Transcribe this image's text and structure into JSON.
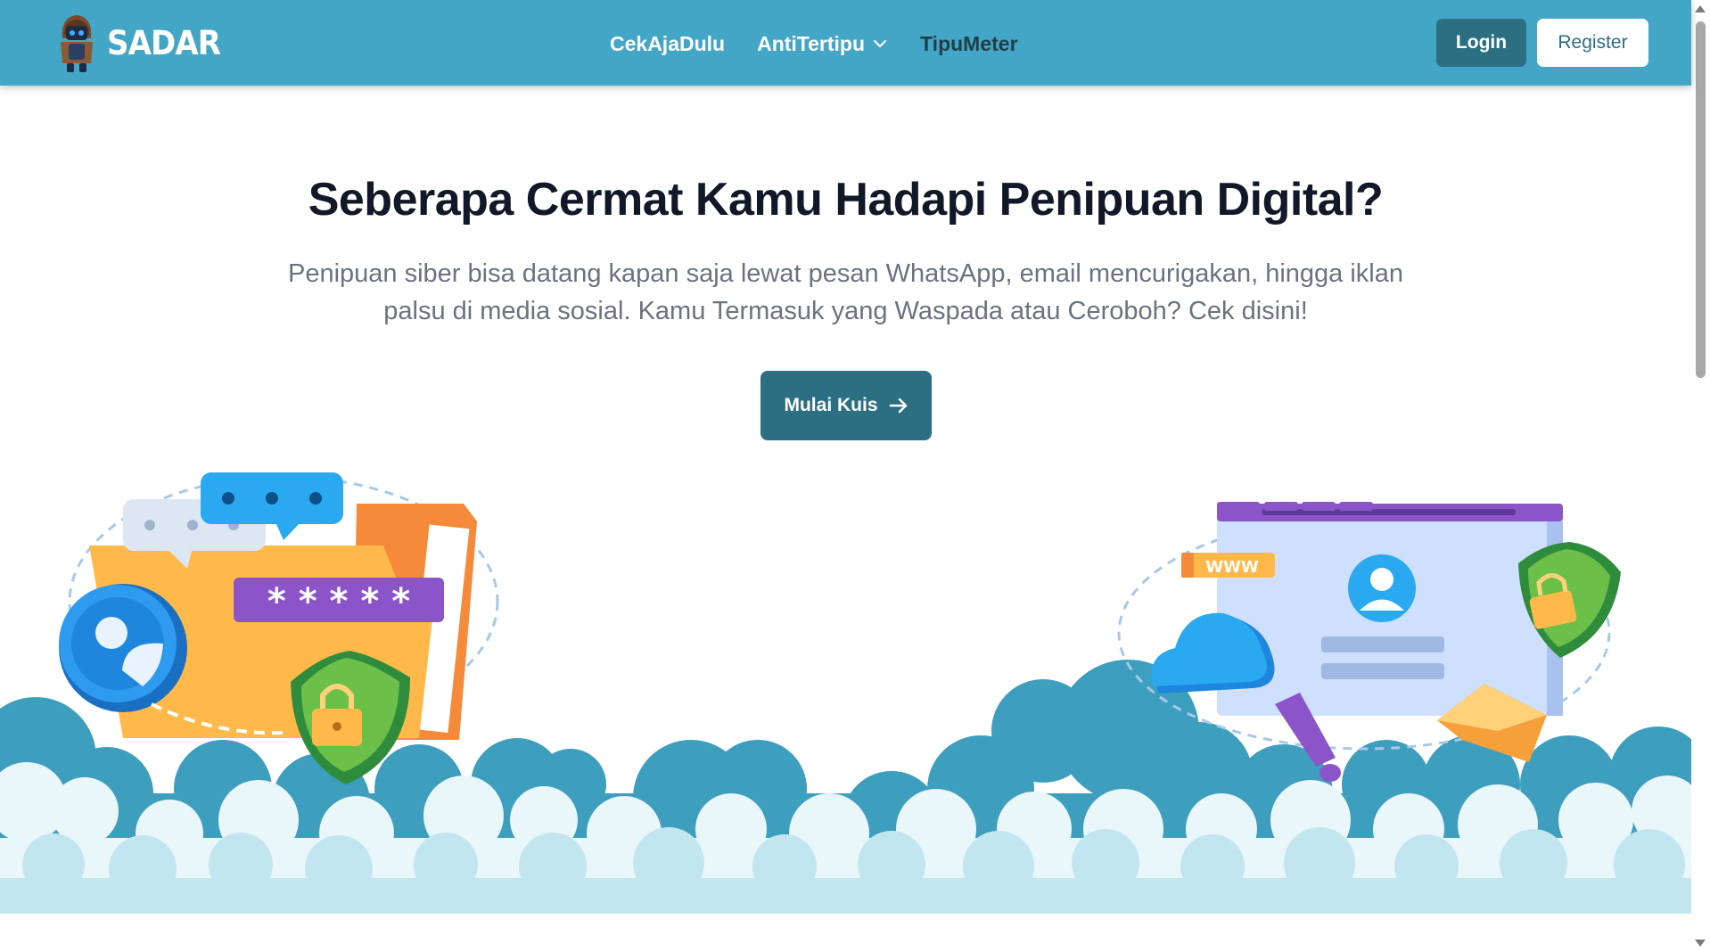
{
  "navbar": {
    "brand": "SADAR",
    "links": [
      {
        "label": "CekAjaDulu"
      },
      {
        "label": "AntiTertipu"
      },
      {
        "label": "TipuMeter"
      }
    ],
    "login_label": "Login",
    "register_label": "Register"
  },
  "hero": {
    "title": "Seberapa Cermat Kamu Hadapi Penipuan Digital?",
    "subtitle": "Penipuan siber bisa datang kapan saja lewat pesan WhatsApp, email mencurigakan, hingga iklan palsu di media sosial. Kamu Termasuk yang Waspada atau Ceroboh? Cek disini!",
    "cta_label": "Mulai Kuis"
  },
  "illustration": {
    "password_mask": "* * * * *",
    "www_label": "WWW"
  },
  "colors": {
    "navbar": "#44a6c6",
    "primary_button": "#2c6f82",
    "title": "#111827",
    "subtitle": "#6b7280"
  }
}
